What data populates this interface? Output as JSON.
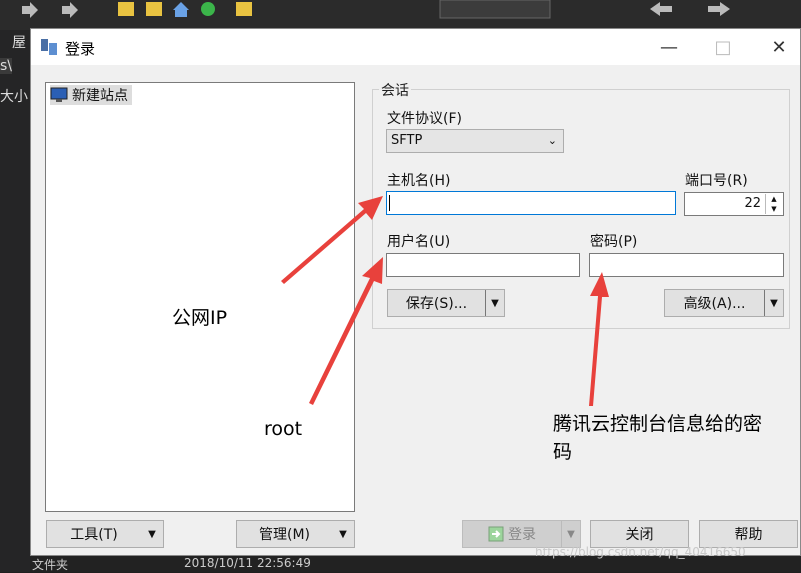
{
  "background": {
    "left_labels": [
      "屋",
      "s\\",
      "大小"
    ],
    "bottom_texts": [
      "文件夹",
      "2018/10/11  22:56:49"
    ]
  },
  "dialog": {
    "title": "登录",
    "tree": {
      "items": [
        {
          "label": "新建站点"
        }
      ]
    },
    "session": {
      "group_title": "会话",
      "protocol_label": "文件协议(F)",
      "protocol_value": "SFTP",
      "host_label": "主机名(H)",
      "host_value": "",
      "port_label": "端口号(R)",
      "port_value": "22",
      "user_label": "用户名(U)",
      "user_value": "",
      "password_label": "密码(P)",
      "password_value": "",
      "save_label": "保存(S)...",
      "advanced_label": "高级(A)..."
    },
    "bottom": {
      "tools_label": "工具(T)",
      "manage_label": "管理(M)",
      "login_label": "登录",
      "close_label": "关闭",
      "help_label": "帮助"
    }
  },
  "annotations": {
    "public_ip": "公网IP",
    "root": "root",
    "password_note_line1": "腾讯云控制台信息给的密",
    "password_note_line2": "码"
  },
  "watermark": "https://blog.csdn.net/qq_40416650",
  "colors": {
    "annotation_arrow": "#e8413c",
    "accent_focus": "#0078d7"
  }
}
